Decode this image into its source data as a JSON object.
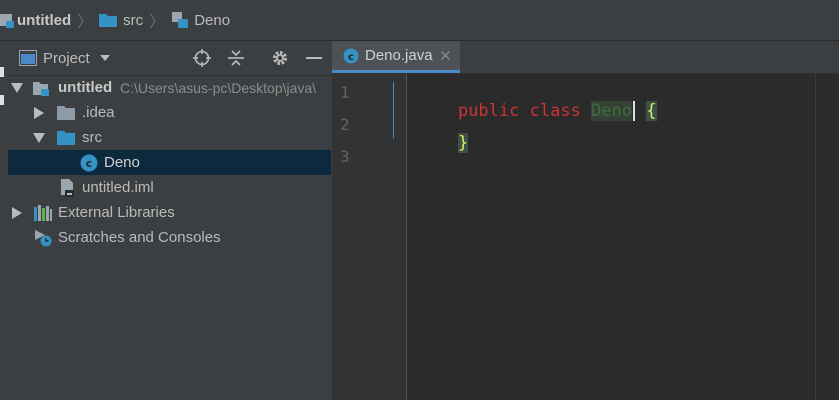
{
  "breadcrumb": {
    "project": "untitled",
    "folder": "src",
    "file": "Deno"
  },
  "project_panel": {
    "title": "Project",
    "tree": [
      {
        "label": "untitled",
        "path": "C:\\Users\\asus-pc\\Desktop\\java\\"
      },
      {
        "label": ".idea"
      },
      {
        "label": "src"
      },
      {
        "label": "Deno"
      },
      {
        "label": "untitled.iml"
      },
      {
        "label": "External Libraries"
      },
      {
        "label": "Scratches and Consoles"
      }
    ]
  },
  "editor": {
    "tab_label": "Deno.java",
    "line_numbers": [
      "1",
      "2",
      "3"
    ],
    "code": {
      "kw_public": "public",
      "kw_class": "class",
      "class_name": "Deno",
      "open_brace": "{",
      "close_brace": "}"
    }
  },
  "colors": {
    "accent": "#4a88c7",
    "keyword": "#cc3333",
    "selection": "#0d293e",
    "class_icon": "#3592c4",
    "folder": "#8e9ba6"
  }
}
